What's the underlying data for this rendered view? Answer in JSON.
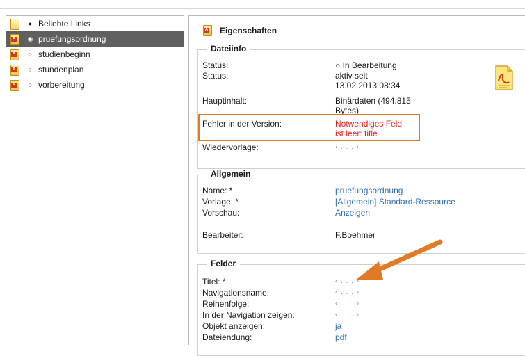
{
  "tree": {
    "items": [
      {
        "label": "Beliebte Links",
        "bullet": "●",
        "selected": false,
        "icon": "document-icon"
      },
      {
        "label": "pruefungsordnung",
        "bullet": "◉",
        "selected": true,
        "icon": "pdf-file-icon"
      },
      {
        "label": "studienbeginn",
        "bullet": "○",
        "selected": false,
        "icon": "pdf-file-icon"
      },
      {
        "label": "stundenplan",
        "bullet": "○",
        "selected": false,
        "icon": "pdf-file-icon"
      },
      {
        "label": "vorbereitung",
        "bullet": "○",
        "selected": false,
        "icon": "pdf-file-icon"
      }
    ]
  },
  "properties": {
    "title": "Eigenschaften",
    "dateiinfo": {
      "legend": "Dateiinfo",
      "status1_label": "Status:",
      "status1_value": "○ In Bearbeitung",
      "status2_label": "Status:",
      "status2_value": "aktiv seit 13.02.2013 08:34",
      "hauptinhalt_label": "Hauptinhalt:",
      "hauptinhalt_value": "Binärdaten (494.815 Bytes)",
      "fehler_label": "Fehler in der Version:",
      "fehler_value": "Notwendiges Feld ist leer: title",
      "wiedervorlage_label": "Wiedervorlage:",
      "wiedervorlage_value": "‹ . . . ›"
    },
    "allgemein": {
      "legend": "Allgemein",
      "name_label": "Name: *",
      "name_value": "pruefungsordnung",
      "vorlage_label": "Vorlage: *",
      "vorlage_value": "[Allgemein] Standard-Ressource",
      "vorschau_label": "Vorschau:",
      "vorschau_value": "Anzeigen",
      "bearbeiter_label": "Bearbeiter:",
      "bearbeiter_value": "F.Boehmer"
    },
    "felder": {
      "legend": "Felder",
      "rows": [
        {
          "label": "Titel: *",
          "value": "‹ . . . ›",
          "kind": "dots"
        },
        {
          "label": "Navigationsname:",
          "value": "‹ . . . ›",
          "kind": "dots"
        },
        {
          "label": "Reihenfolge:",
          "value": "‹ . . . ›",
          "kind": "dots"
        },
        {
          "label": "In der Navigation zeigen:",
          "value": "‹ . . . ›",
          "kind": "dots"
        },
        {
          "label": "Objekt anzeigen:",
          "value": "ja",
          "kind": "link"
        },
        {
          "label": "Dateiendung:",
          "value": "pdf",
          "kind": "link"
        }
      ]
    }
  },
  "colors": {
    "highlight": "#e07a25",
    "link": "#2e6db6",
    "error": "#e0231b",
    "selected_row": "#5f5f5f"
  }
}
